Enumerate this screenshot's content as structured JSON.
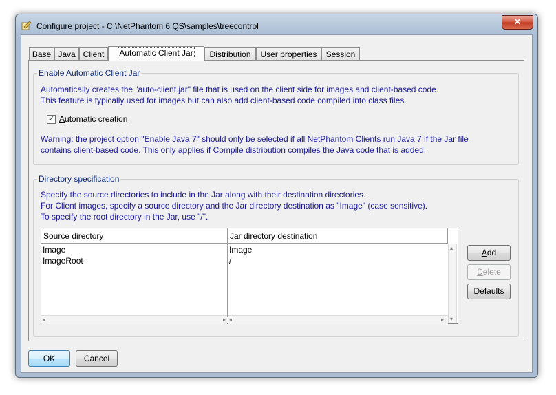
{
  "window": {
    "title": "Configure project - C:\\NetPhantom 6 QS\\samples\\treecontrol",
    "close_glyph": "✕"
  },
  "tabs": [
    {
      "label": "Base"
    },
    {
      "label": "Java"
    },
    {
      "label": "Client"
    },
    {
      "label": "Automatic Client Jar",
      "active": true
    },
    {
      "label": "Distribution"
    },
    {
      "label": "User properties"
    },
    {
      "label": "Session"
    }
  ],
  "enable_group": {
    "legend": "Enable Automatic Client Jar",
    "description_line1": "Automatically creates the \"auto-client.jar\" file that is used on the client side for images and client-based code.",
    "description_line2": "This feature is typically used for images but can also add client-based code compiled into class files.",
    "checkbox_label_prefix": "",
    "checkbox_label_underlined": "A",
    "checkbox_label_rest": "utomatic creation",
    "checkbox_checked": true,
    "warning_line1": "Warning: the project option \"Enable Java 7\" should only be selected if all NetPhantom Clients run Java 7 if the Jar file",
    "warning_line2": "contains client-based code. This only applies if Compile distribution compiles the Java code that is added."
  },
  "directory_group": {
    "legend": "Directory specification",
    "line1": "Specify the source directories to include in the Jar along with their destination directories.",
    "line2": "For Client images, specify a source directory and the Jar directory destination as \"Image\" (case sensitive).",
    "line3": "To specify the root directory in the Jar, use \"/\".",
    "columns": [
      "Source directory",
      "Jar directory destination"
    ],
    "rows": [
      {
        "source": "Image",
        "destination": "Image"
      },
      {
        "source": "ImageRoot",
        "destination": "/"
      }
    ]
  },
  "side_buttons": {
    "add_u": "A",
    "add_rest": "dd",
    "delete_u": "D",
    "delete_rest": "elete",
    "defaults": "Defaults"
  },
  "footer": {
    "ok": "OK",
    "cancel": "Cancel"
  },
  "colors": {
    "accent_text": "#1b1b9b",
    "legend_text": "#0c2a7a",
    "close_button": "#c23a22"
  },
  "icons": [
    "app-icon",
    "close-icon",
    "checkmark-icon",
    "scroll-left-icon",
    "scroll-right-icon",
    "scroll-up-icon",
    "scroll-down-icon"
  ]
}
